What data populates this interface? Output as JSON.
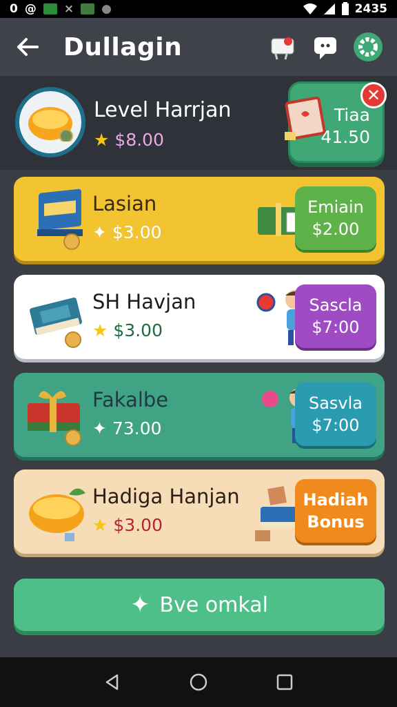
{
  "status_bar": {
    "left_text": "0",
    "time": "2435"
  },
  "header": {
    "title": "Dullagin",
    "icons": [
      "back-arrow-icon",
      "mail-icon",
      "chat-icon",
      "gear-icon"
    ]
  },
  "level": {
    "title": "Level Harrjan",
    "price": "$8.00",
    "reward": {
      "line1": "Tiaa",
      "line2": "41.50"
    }
  },
  "offers": [
    {
      "name": "Lasian",
      "price": "$3.00",
      "cta_line1": "Emiain",
      "cta_line2": "$2.00",
      "icon": "book-icon"
    },
    {
      "name": "SH Havjan",
      "price": "$3.00",
      "cta_line1": "Sascla",
      "cta_line2": "$7:00",
      "icon": "book-icon"
    },
    {
      "name": "Fakalbe",
      "price": "73.00",
      "cta_line1": "Sasvla",
      "cta_line2": "$7:00",
      "icon": "gift-icon"
    },
    {
      "name": "Hadiga Hanjan",
      "price": "$3.00",
      "cta_line1": "Hadiah",
      "cta_line2": "Bonus",
      "icon": "orange-icon"
    }
  ],
  "bottom_button": {
    "label": "Bve omkal"
  },
  "colors": {
    "background": "#3a3d44",
    "card_yellow": "#f2c431",
    "card_white": "#ffffff",
    "card_teal": "#3fa384",
    "card_peach": "#f7dcb8",
    "accent_green": "#4fbf8a"
  }
}
